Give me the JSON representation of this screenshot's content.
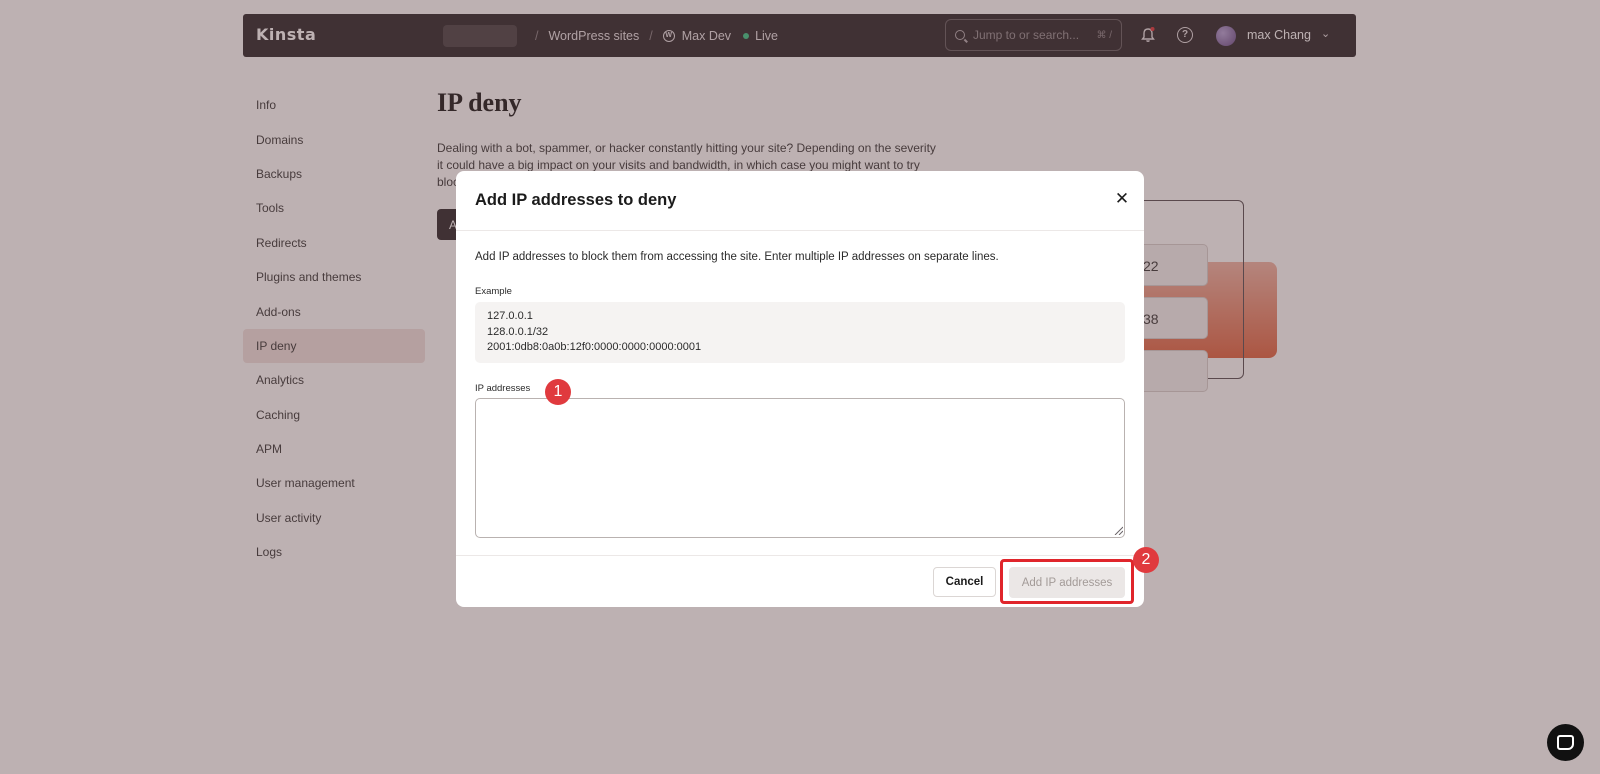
{
  "header": {
    "logo": "Kinsta",
    "breadcrumbs": [
      "WordPress sites",
      "Max Dev"
    ],
    "env_status": "Live",
    "search_placeholder": "Jump to or search...",
    "search_shortcut": "⌘ /",
    "username": "max Chang"
  },
  "sidebar": {
    "items": [
      {
        "label": "Info"
      },
      {
        "label": "Domains"
      },
      {
        "label": "Backups"
      },
      {
        "label": "Tools"
      },
      {
        "label": "Redirects"
      },
      {
        "label": "Plugins and themes"
      },
      {
        "label": "Add-ons"
      },
      {
        "label": "IP deny",
        "active": true
      },
      {
        "label": "Analytics"
      },
      {
        "label": "Caching"
      },
      {
        "label": "APM"
      },
      {
        "label": "User management"
      },
      {
        "label": "User activity"
      },
      {
        "label": "Logs"
      }
    ]
  },
  "page": {
    "title": "IP deny",
    "description": "Dealing with a bot, spammer, or hacker constantly hitting your site? Depending on the severity it could have a big impact on your visits and bandwidth, in which case you might want to try bloc",
    "button_partial": "A",
    "illustration_cards": [
      "22",
      "38",
      ""
    ]
  },
  "modal": {
    "title": "Add IP addresses to deny",
    "description": "Add IP addresses to block them from accessing the site. Enter multiple IP addresses on separate lines.",
    "example_label": "Example",
    "example_lines": [
      "127.0.0.1",
      "128.0.0.1/32",
      "2001:0db8:0a0b:12f0:0000:0000:0000:0001"
    ],
    "ip_label": "IP addresses",
    "ip_value": "",
    "cancel_label": "Cancel",
    "submit_label": "Add IP addresses"
  },
  "annotations": {
    "step1": "1",
    "step2": "2",
    "highlight_color": "#e0252b"
  },
  "colors": {
    "header_bg": "#2f2a2e",
    "live_dot": "#3ec98a",
    "active_nav": "#f2e3e1",
    "badge": "#e03a3e"
  }
}
